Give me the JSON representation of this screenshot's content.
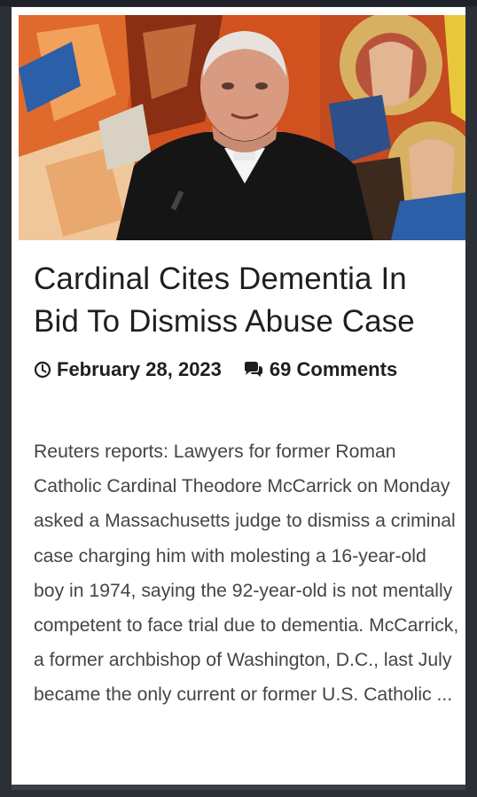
{
  "article": {
    "title": "Cardinal Cites Dementia In Bid To Dismiss Abuse Case",
    "date": "February 28, 2023",
    "comments": "69 Comments",
    "excerpt": "Reuters reports: Lawyers for former Roman Catholic Cardinal Theodore McCarrick on Monday asked a Massachusetts judge to dismiss a criminal case charging him with molesting a 16-year-old boy in 1974, saying the 92-year-old is not mentally competent to face trial due to dementia. McCarrick, a former archbishop of Washington, D.C., last July became the only current or former U.S. Catholic ..."
  },
  "icons": {
    "date": "clock-icon",
    "comments": "comments-icon"
  },
  "colors": {
    "background": "#2b2f36",
    "card": "#ffffff",
    "title": "#1f1f1f",
    "body": "#454545"
  }
}
